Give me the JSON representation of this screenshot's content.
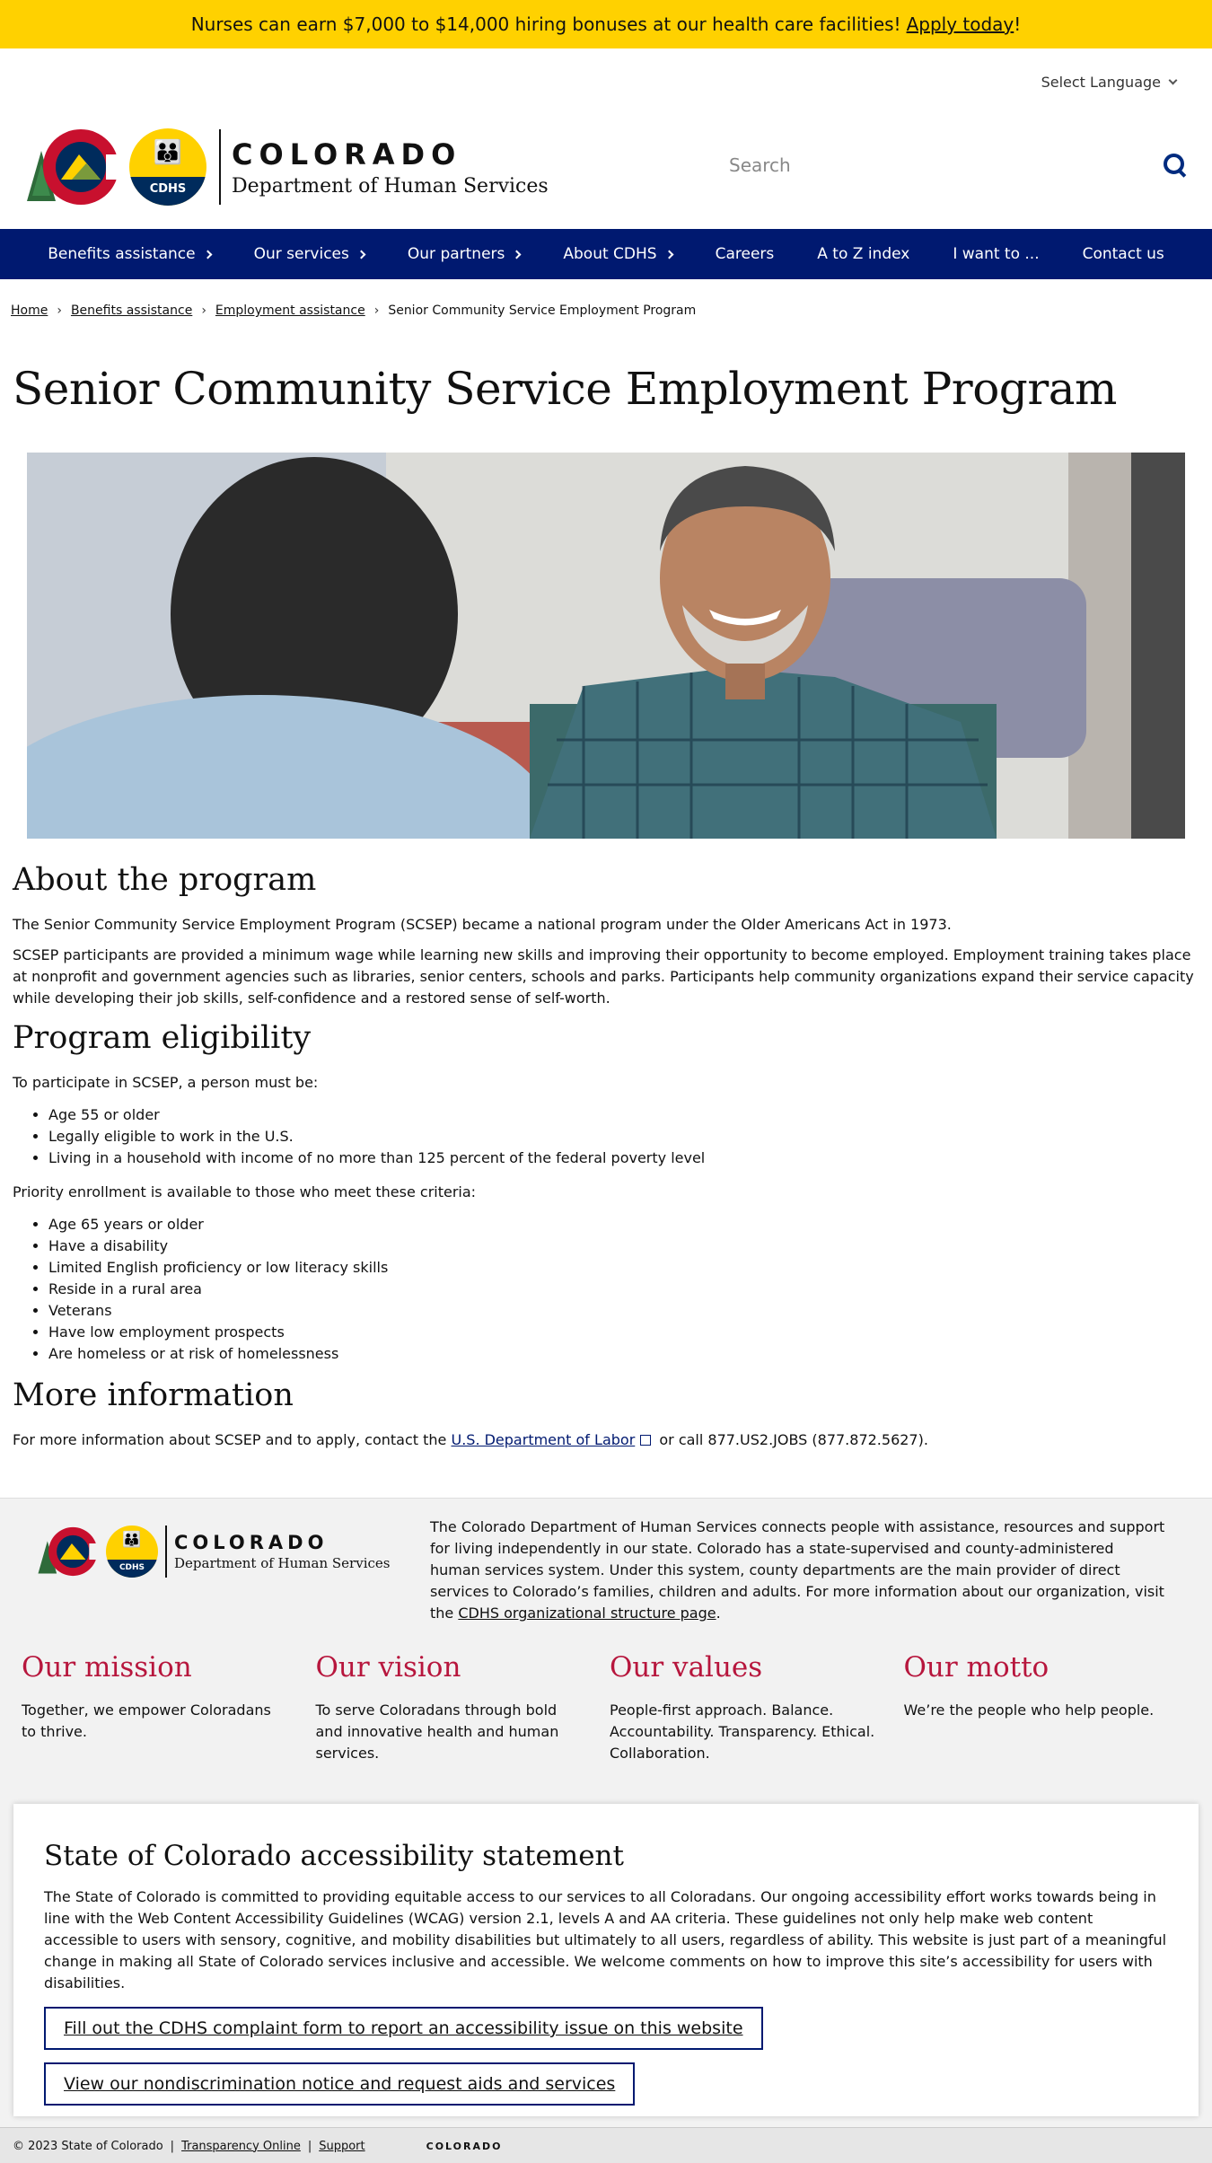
{
  "alert": {
    "text": "Nurses can earn $7,000 to $14,000 hiring bonuses at our health care facilities!",
    "link_text": "Apply today",
    "suffix": "!"
  },
  "header": {
    "language_label": "Select Language",
    "logo_state": "COLORADO",
    "logo_dept": "Department of Human Services",
    "logo_badge": "CDHS",
    "search_placeholder": "Search"
  },
  "nav": {
    "items": [
      {
        "label": "Benefits assistance",
        "has_submenu": true
      },
      {
        "label": "Our services",
        "has_submenu": true
      },
      {
        "label": "Our partners",
        "has_submenu": true
      },
      {
        "label": "About CDHS",
        "has_submenu": true
      },
      {
        "label": "Careers",
        "has_submenu": false
      },
      {
        "label": "A to Z index",
        "has_submenu": false
      },
      {
        "label": "I want to ...",
        "has_submenu": false
      },
      {
        "label": "Contact us",
        "has_submenu": false
      }
    ]
  },
  "breadcrumb": {
    "home": "Home",
    "benefits": "Benefits assistance",
    "employment": "Employment assistance",
    "current": "Senior Community Service Employment Program",
    "separator": "›"
  },
  "page": {
    "title": "Senior Community Service Employment Program"
  },
  "about": {
    "heading": "About the program",
    "p1": "The Senior Community Service Employment Program (SCSEP) became a national program under the Older Americans Act in 1973.",
    "p2": "SCSEP participants are provided a minimum wage while learning new skills and improving their opportunity to become employed. Employment training takes place at nonprofit and government agencies such as libraries, senior centers, schools and parks. Participants help community organizations expand their service capacity while developing their job skills, self-confidence and a restored sense of self-worth."
  },
  "eligibility": {
    "heading": "Program eligibility",
    "intro": "To participate in SCSEP, a person must be:",
    "requirements": [
      "Age 55 or older",
      "Legally eligible to work in the U.S.",
      "Living in a household with income of no more than 125 percent of the federal poverty level"
    ],
    "priority_intro": "Priority enrollment is available to those who meet these criteria:",
    "priority": [
      "Age 65 years or older",
      "Have a disability",
      "Limited English proficiency or low literacy skills",
      "Reside in a rural area",
      "Veterans",
      "Have low employment prospects",
      "Are homeless or at risk of homelessness"
    ]
  },
  "more_info": {
    "heading": "More information",
    "before": "For more information about SCSEP and to apply, contact the",
    "link_text": "U.S. Department of Labor",
    "after": "or call 877.US2.JOBS (877.872.5627)."
  },
  "footer": {
    "about_text": "The Colorado Department of Human Services connects people with assistance, resources and support for living independently in our state. Colorado has a state-supervised and county-administered human services system. Under this system, county departments are the main provider of direct services to Colorado’s families, children and adults. For more information about our organization, visit the",
    "about_link": "CDHS organizational structure page",
    "about_end": ".",
    "pillars": [
      {
        "title": "Our mission",
        "text": "Together, we empower Coloradans to thrive."
      },
      {
        "title": "Our vision",
        "text": "To serve Coloradans through bold and innovative health and human services."
      },
      {
        "title": "Our values",
        "text": "People-first approach. Balance. Accountability. Transparency. Ethical. Collaboration."
      },
      {
        "title": "Our motto",
        "text": "We’re the people who help people."
      }
    ],
    "accessibility": {
      "heading": "State of Colorado accessibility statement",
      "text": "The State of Colorado is committed to providing equitable access to our services to all Coloradans. Our ongoing accessibility effort works towards being in line with the Web Content Accessibility Guidelines (WCAG) version 2.1, levels A and AA criteria. These guidelines not only help make web content accessible to users with sensory, cognitive, and mobility disabilities but ultimately to all users, regardless of ability. This website is just part of a meaningful change in making all State of Colorado services inclusive and accessible. We welcome comments on how to improve this site’s accessibility for users with disabilities.",
      "button1": "Fill out the CDHS complaint form to report an accessibility issue on this website",
      "button2": "View our nondiscrimination notice and request aids and services"
    },
    "legal": {
      "copyright": "© 2023 State of Colorado",
      "transparency": "Transparency Online",
      "support": "Support",
      "divider": "|",
      "mini_state": "COLORADO"
    }
  },
  "colors": {
    "alert_bg": "#ffd100",
    "nav_bg": "#001970",
    "accent_red": "#b7163d",
    "footer_bg": "#f2f2f2"
  }
}
